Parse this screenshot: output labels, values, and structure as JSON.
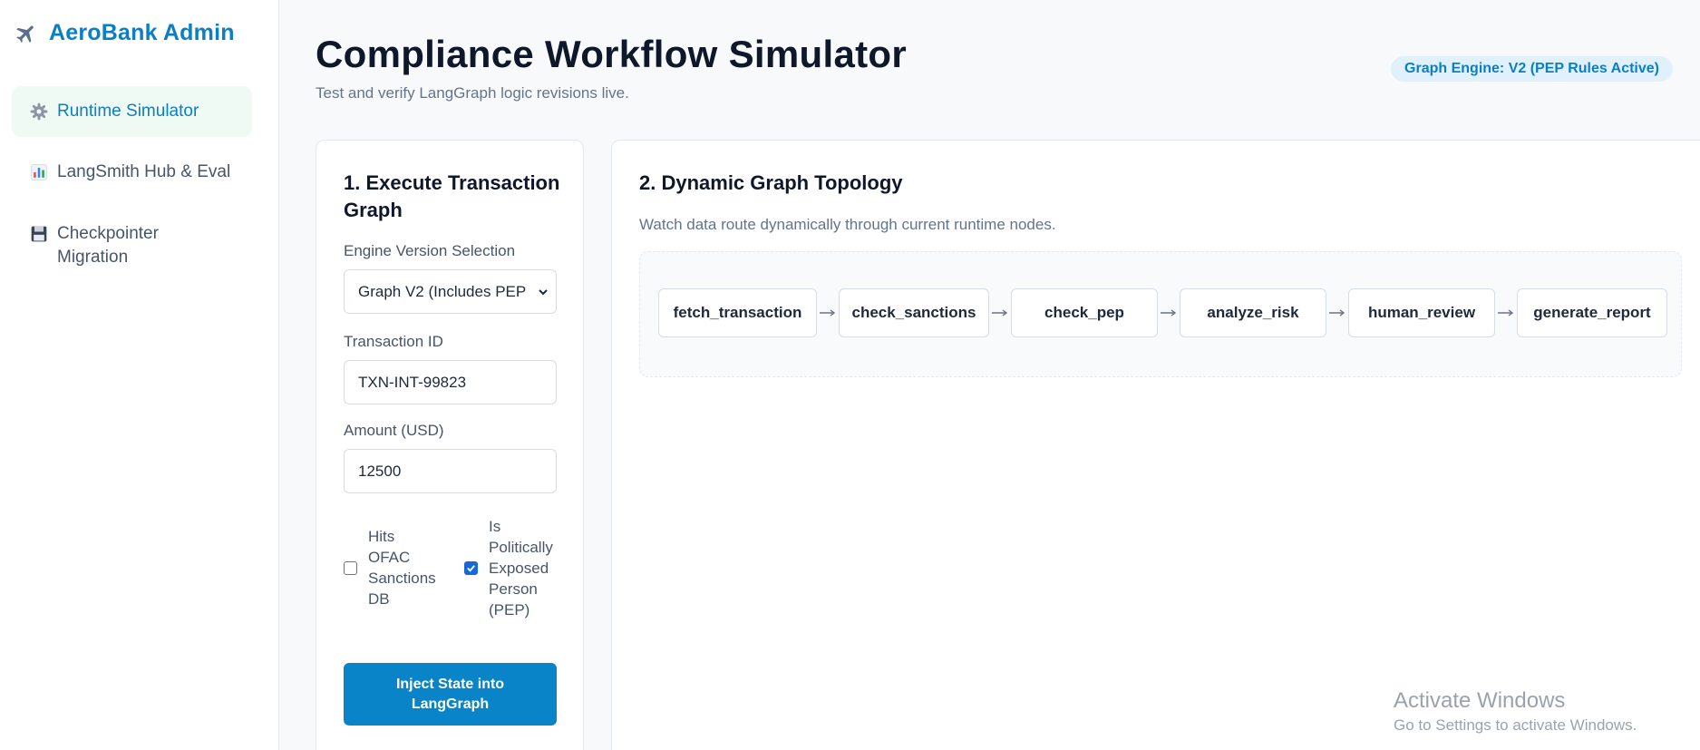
{
  "sidebar": {
    "brand": "AeroBank Admin",
    "items": [
      {
        "label": "Runtime Simulator",
        "icon": "gear-icon",
        "active": true
      },
      {
        "label": "LangSmith Hub & Eval",
        "icon": "bar-chart-icon",
        "active": false
      },
      {
        "label": "Checkpointer Migration",
        "icon": "floppy-disk-icon",
        "active": false
      }
    ]
  },
  "header": {
    "title": "Compliance Workflow Simulator",
    "subtitle": "Test and verify LangGraph logic revisions live.",
    "badge": "Graph Engine: V2 (PEP Rules Active)"
  },
  "execute_panel": {
    "title": "1. Execute Transaction Graph",
    "engine_label": "Engine Version Selection",
    "engine_value": "Graph V2 (Includes PEP",
    "txn_label": "Transaction ID",
    "txn_value": "TXN-INT-99823",
    "amount_label": "Amount (USD)",
    "amount_value": "12500",
    "checks": [
      {
        "label": "Hits OFAC Sanctions DB",
        "checked": false
      },
      {
        "label": "Is Politically Exposed Person (PEP)",
        "checked": true
      }
    ],
    "button": "Inject State into LangGraph"
  },
  "topology_panel": {
    "title": "2. Dynamic Graph Topology",
    "description": "Watch data route dynamically through current runtime nodes.",
    "nodes": [
      "fetch_transaction",
      "check_sanctions",
      "check_pep",
      "analyze_risk",
      "human_review",
      "generate_report"
    ]
  },
  "watermark": {
    "title": "Activate Windows",
    "subtitle": "Go to Settings to activate Windows."
  },
  "colors": {
    "accent": "#0a7fc4",
    "active_nav_bg": "#effaf4",
    "button": "#0a84c8",
    "badge_bg": "#e0f1fb"
  }
}
